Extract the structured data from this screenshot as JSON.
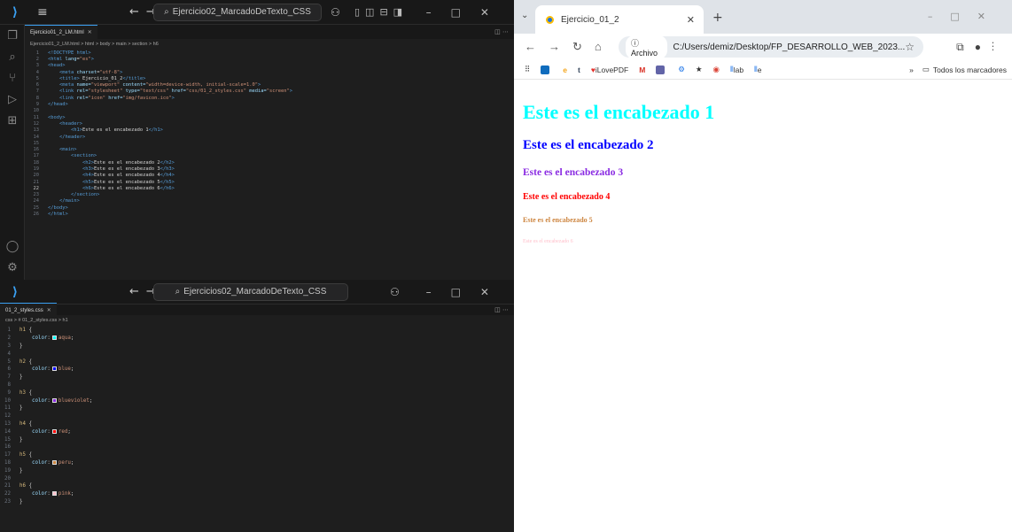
{
  "vscode_top": {
    "search": "Ejercicio02_MarcadoDeTexto_CSS",
    "tab_label": "Ejercicio01_2_LM.html",
    "breadcrumb": "Ejercicio01_2_LM.html > html > body > main > section > h6",
    "lines": [
      {
        "n": "1",
        "html": "<span class='t-tag'>&lt;!DOCTYPE html&gt;</span>"
      },
      {
        "n": "2",
        "html": "<span class='t-tag'>&lt;html </span><span class='t-attr'>lang</span><span class='t-txt'>=</span><span class='t-str'>\"es\"</span><span class='t-tag'>&gt;</span>"
      },
      {
        "n": "3",
        "html": "<span class='t-tag'>&lt;head&gt;</span>"
      },
      {
        "n": "4",
        "html": "    <span class='t-tag'>&lt;meta </span><span class='t-attr'>charset</span><span class='t-txt'>=</span><span class='t-str'>\"utf-8\"</span><span class='t-tag'>&gt;</span>"
      },
      {
        "n": "5",
        "html": "    <span class='t-tag'>&lt;title&gt;</span><span class='t-txt'> Ejercicio_01_2</span><span class='t-tag'>&lt;/title&gt;</span>"
      },
      {
        "n": "6",
        "html": "    <span class='t-tag'>&lt;meta </span><span class='t-attr'>name</span>=<span class='t-str'>\"viewport\"</span> <span class='t-attr'>content</span>=<span class='t-str'>\"width=device-width, initial-scale=1.0\"</span><span class='t-tag'>&gt;</span>"
      },
      {
        "n": "7",
        "html": "    <span class='t-tag'>&lt;link </span><span class='t-attr'>rel</span>=<span class='t-str'>\"stylesheet\"</span> <span class='t-attr'>type</span>=<span class='t-str'>\"text/css\"</span> <span class='t-attr'>href</span>=<span class='t-str'>\"css/01_2_styles.css\"</span> <span class='t-attr'>media</span>=<span class='t-str'>\"screen\"</span><span class='t-tag'>&gt;</span>"
      },
      {
        "n": "8",
        "html": "    <span class='t-tag'>&lt;link </span><span class='t-attr'>rel</span>=<span class='t-str'>\"icon\"</span> <span class='t-attr'>href</span>=<span class='t-str'>\"img/favicon.ico\"</span><span class='t-tag'>&gt;</span>"
      },
      {
        "n": "9",
        "html": "<span class='t-tag'>&lt;/head&gt;</span>"
      },
      {
        "n": "10",
        "html": ""
      },
      {
        "n": "11",
        "html": "<span class='t-tag'>&lt;body&gt;</span>"
      },
      {
        "n": "12",
        "html": "    <span class='t-tag'>&lt;header&gt;</span>"
      },
      {
        "n": "13",
        "html": "        <span class='t-tag'>&lt;h1&gt;</span><span class='t-txt'>Este es el encabezado 1</span><span class='t-tag'>&lt;/h1&gt;</span>"
      },
      {
        "n": "14",
        "html": "    <span class='t-tag'>&lt;/header&gt;</span>"
      },
      {
        "n": "15",
        "html": ""
      },
      {
        "n": "16",
        "html": "    <span class='t-tag'>&lt;main&gt;</span>"
      },
      {
        "n": "17",
        "html": "        <span class='t-tag'>&lt;section&gt;</span>"
      },
      {
        "n": "18",
        "html": "            <span class='t-tag'>&lt;h2&gt;</span><span class='t-txt'>Este es el encabezado 2</span><span class='t-tag'>&lt;/h2&gt;</span>"
      },
      {
        "n": "19",
        "html": "            <span class='t-tag'>&lt;h3&gt;</span><span class='t-txt'>Este es el encabezado 3</span><span class='t-tag'>&lt;/h3&gt;</span>"
      },
      {
        "n": "20",
        "html": "            <span class='t-tag'>&lt;h4&gt;</span><span class='t-txt'>Este es el encabezado 4</span><span class='t-tag'>&lt;/h4&gt;</span>"
      },
      {
        "n": "21",
        "html": "            <span class='t-tag'>&lt;h5&gt;</span><span class='t-txt'>Este es el encabezado 5</span><span class='t-tag'>&lt;/h5&gt;</span>"
      },
      {
        "n": "22",
        "html": "            <span class='t-tag'>&lt;h6&gt;</span><span class='t-txt'>Este es el encabezado 6</span><span class='t-tag'>&lt;/h6&gt;</span>"
      },
      {
        "n": "23",
        "html": "        <span class='t-tag'>&lt;/section&gt;</span>"
      },
      {
        "n": "24",
        "html": "    <span class='t-tag'>&lt;/main&gt;</span>"
      },
      {
        "n": "25",
        "html": "<span class='t-tag'>&lt;/body&gt;</span>"
      },
      {
        "n": "26",
        "html": "<span class='t-tag'>&lt;/html&gt;</span>"
      }
    ]
  },
  "vscode_bottom": {
    "search": "Ejercicios02_MarcadoDeTexto_CSS",
    "tab_label": "01_2_styles.css",
    "breadcrumb": "css > # 01_2_styles.css > h1",
    "rules": [
      {
        "sel": "h1",
        "prop": "color",
        "value": "aqua",
        "color": "#00ffff"
      },
      {
        "sel": "h2",
        "prop": "color",
        "value": "blue",
        "color": "#0000ff"
      },
      {
        "sel": "h3",
        "prop": "color",
        "value": "blueviolet",
        "color": "#8a2be2"
      },
      {
        "sel": "h4",
        "prop": "color",
        "value": "red",
        "color": "#ff0000"
      },
      {
        "sel": "h5",
        "prop": "color",
        "value": "peru",
        "color": "#cd853f"
      },
      {
        "sel": "h6",
        "prop": "color",
        "value": "pink",
        "color": "#ffc0cb"
      }
    ]
  },
  "chrome": {
    "tab_title": "Ejercicio_01_2",
    "chip": "Archivo",
    "url": "C:/Users/demiz/Desktop/FP_DESARROLLO_WEB_2023...",
    "bookmarks": [
      "iLovePDF",
      "M",
      "lab",
      "e"
    ],
    "bookmarks_right": "Todos los marcadores",
    "headings": [
      {
        "text": "Este es el encabezado 1",
        "color": "#00ffff"
      },
      {
        "text": "Este es el encabezado 2",
        "color": "#0000ff"
      },
      {
        "text": "Este es el encabezado 3",
        "color": "#8a2be2"
      },
      {
        "text": "Este es el encabezado 4",
        "color": "#ff0000"
      },
      {
        "text": "Este es el encabezado 5",
        "color": "#cd853f"
      },
      {
        "text": "Este es el encabezado 6",
        "color": "#ffc0cb"
      }
    ]
  }
}
